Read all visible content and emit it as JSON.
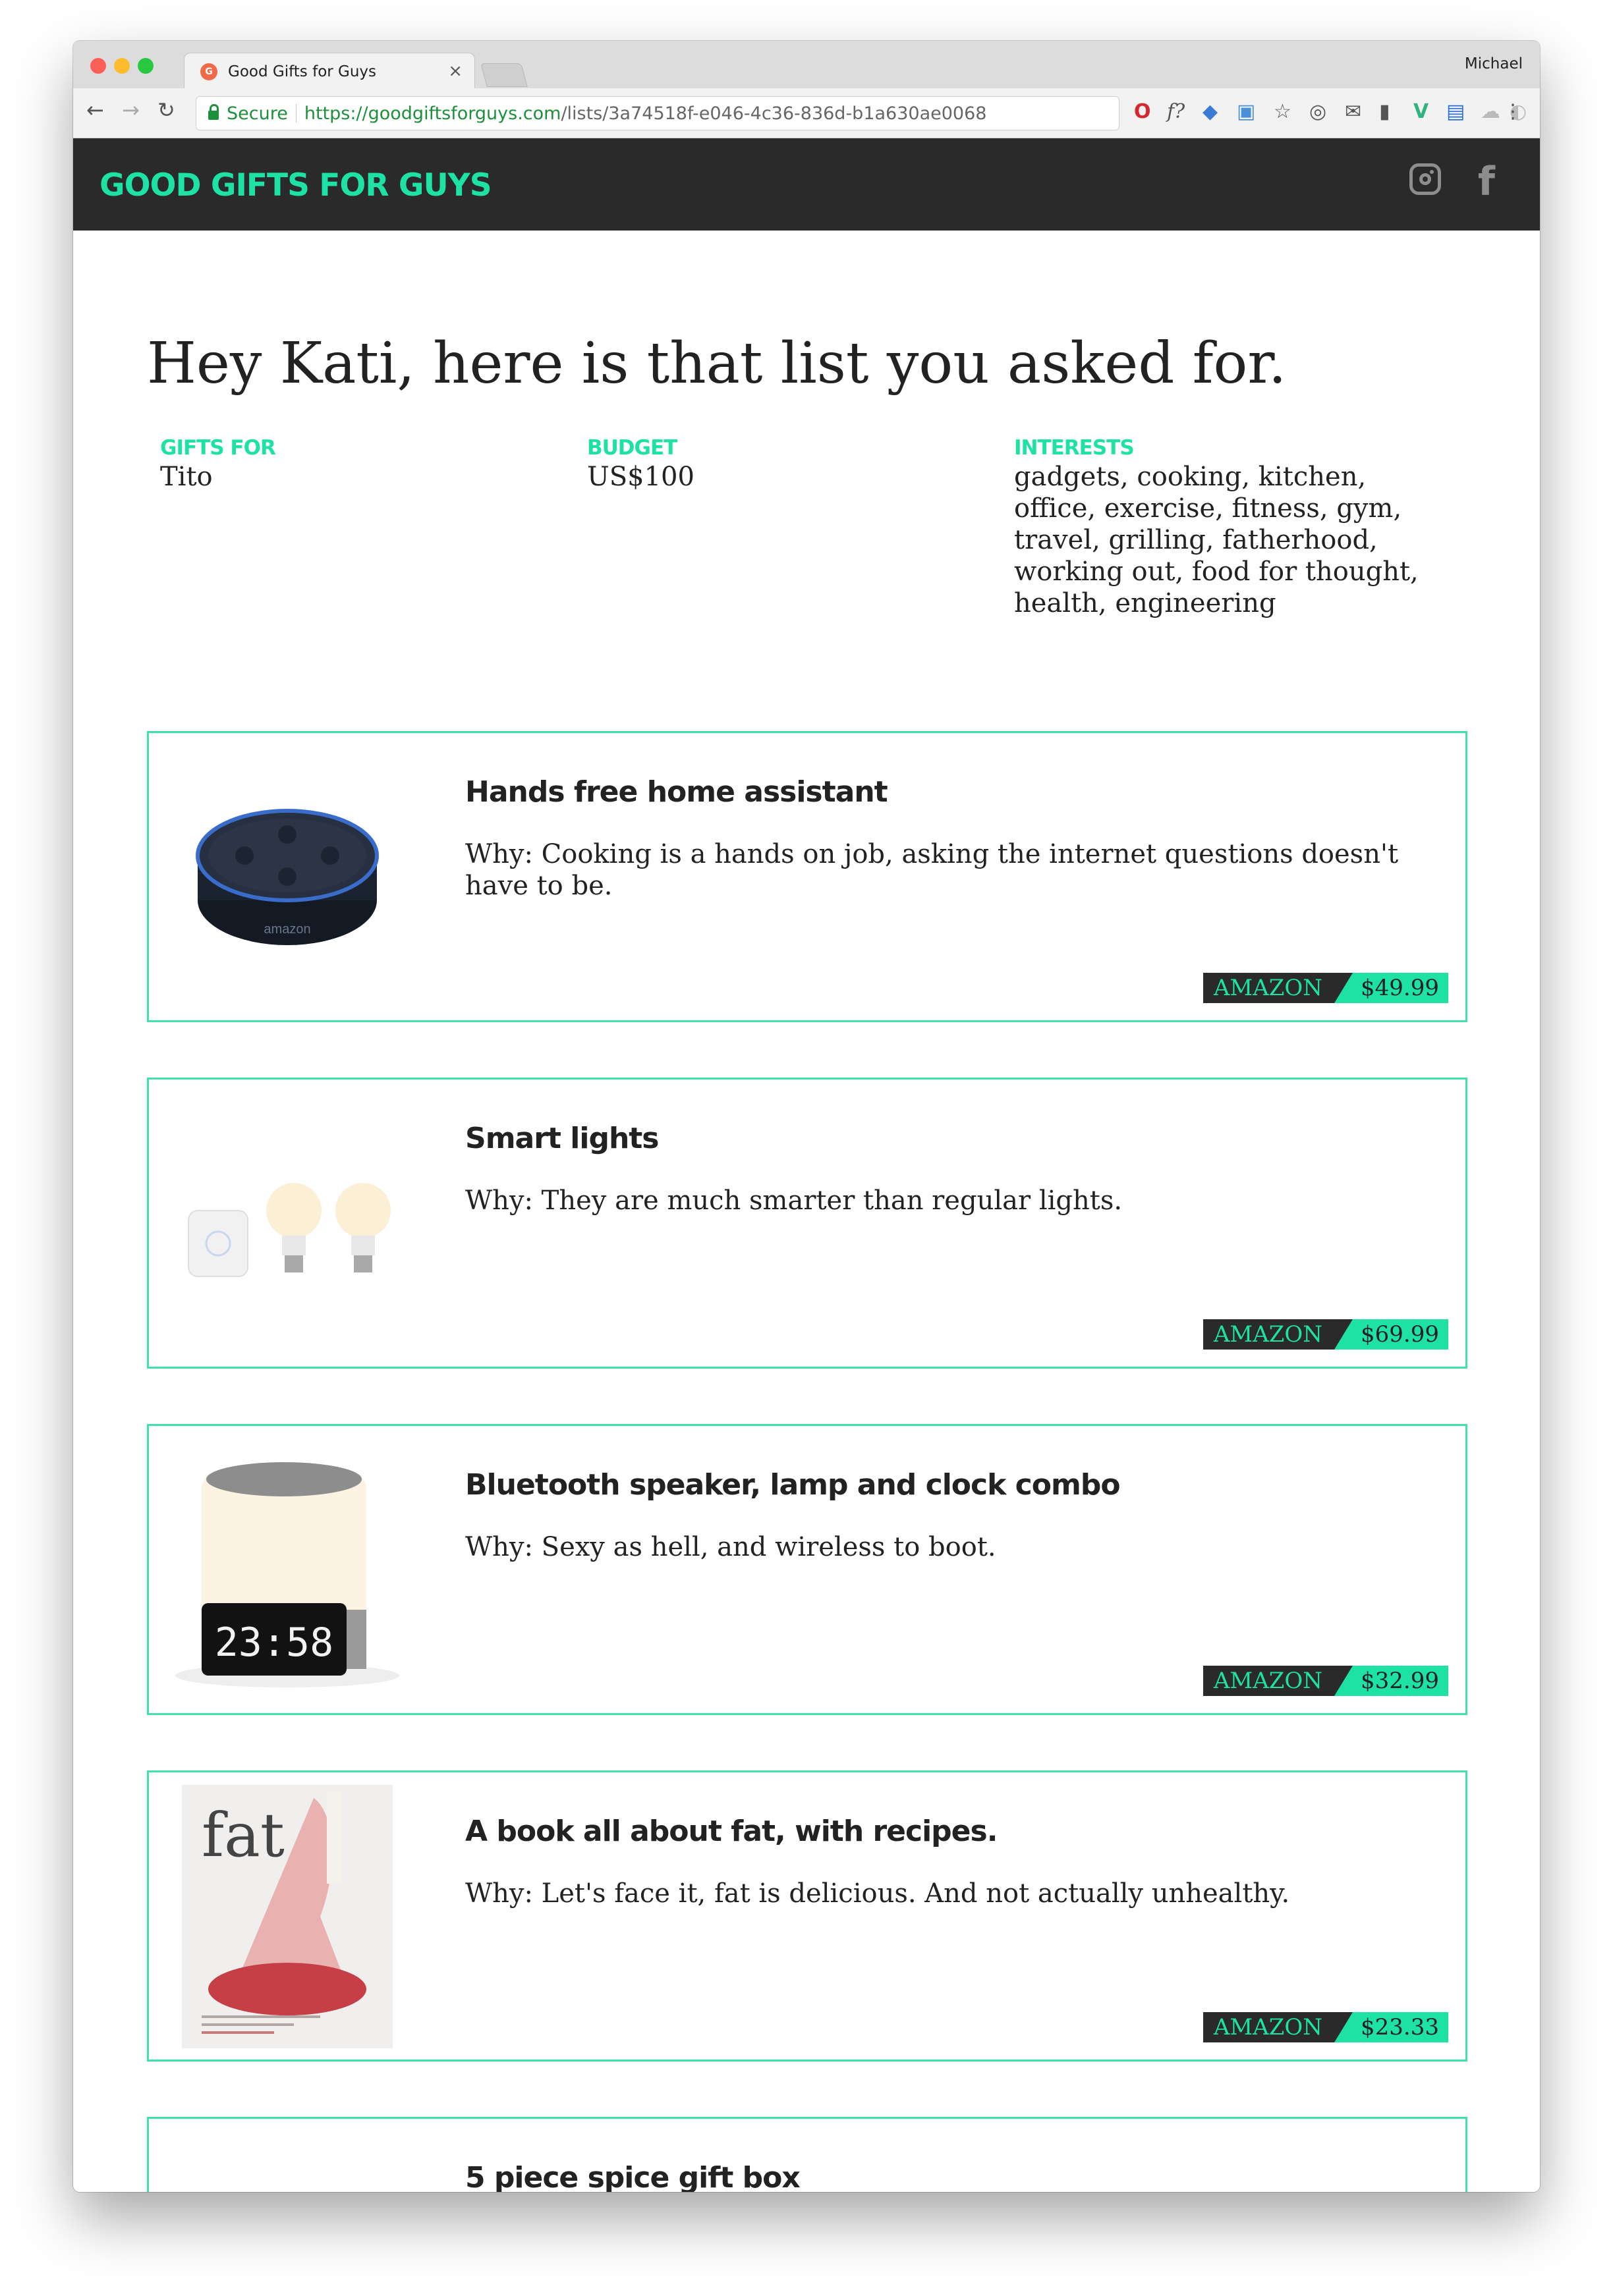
{
  "browser": {
    "tab_title": "Good Gifts for Guys",
    "tab_close": "×",
    "profile_name": "Michael",
    "secure_label": "Secure",
    "url_scheme_host": "https://goodgiftsforguys.com",
    "url_path": "/lists/3a74518f-e046-4c36-836d-b1a630ae0068"
  },
  "site": {
    "logo": "GOOD GIFTS FOR GUYS",
    "headline": "Hey Kati, here is that list you asked for.",
    "meta": {
      "gifts_for_label": "GIFTS FOR",
      "gifts_for_value": "Tito",
      "budget_label": "BUDGET",
      "budget_value": "US$100",
      "interests_label": "INTERESTS",
      "interests_value": "gadgets, cooking, kitchen, office, exercise, fitness, gym, travel, grilling, fatherhood, working out, food for thought, health, engineering"
    },
    "gifts": [
      {
        "title": "Hands free home assistant",
        "why": "Why: Cooking is a hands on job, asking the internet questions doesn't have to be.",
        "store": "AMAZON",
        "price": "$49.99",
        "image_brand": "amazon"
      },
      {
        "title": "Smart lights",
        "why": "Why: They are much smarter than regular lights.",
        "store": "AMAZON",
        "price": "$69.99"
      },
      {
        "title": "Bluetooth speaker, lamp and clock combo",
        "why": "Why: Sexy as hell, and wireless to boot.",
        "store": "AMAZON",
        "price": "$32.99",
        "image_clock": "23:58"
      },
      {
        "title": "A book all about fat, with recipes.",
        "why": "Why: Let's face it, fat is delicious. And not actually unhealthy.",
        "store": "AMAZON",
        "price": "$23.33",
        "image_cover": "fat"
      },
      {
        "title": "5 piece spice gift box",
        "why": ""
      }
    ]
  },
  "colors": {
    "accent": "#1de2a4",
    "header_bg": "#2a2a2a",
    "card_border": "#41e1ae"
  }
}
